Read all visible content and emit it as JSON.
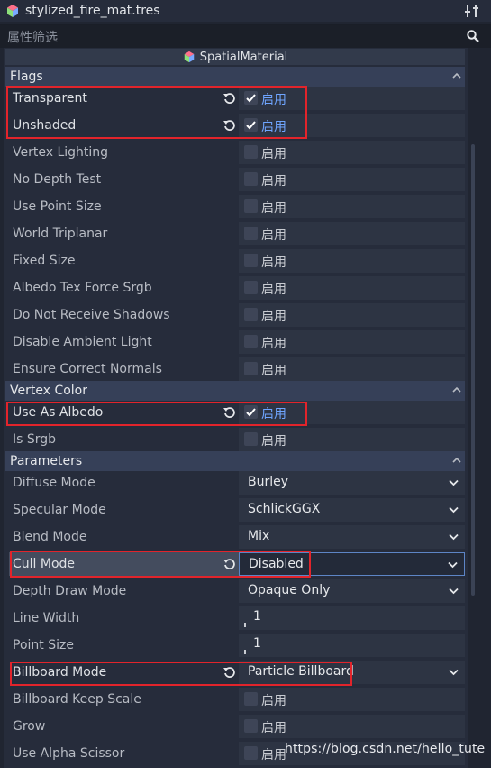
{
  "header": {
    "file_title": "stylized_fire_mat.tres",
    "resource_icon": "cube-icon",
    "tools_icon": "tools-icon"
  },
  "filter": {
    "placeholder": "属性筛选",
    "search_icon": "search-icon"
  },
  "material": {
    "class_name": "SpatialMaterial",
    "icon": "spatial-material-icon"
  },
  "enable_label": "启用",
  "sections": {
    "flags": "Flags",
    "vertex_color": "Vertex Color",
    "parameters": "Parameters"
  },
  "flags": [
    {
      "label": "Transparent",
      "checked": true
    },
    {
      "label": "Unshaded",
      "checked": true
    },
    {
      "label": "Vertex Lighting",
      "checked": false
    },
    {
      "label": "No Depth Test",
      "checked": false
    },
    {
      "label": "Use Point Size",
      "checked": false
    },
    {
      "label": "World Triplanar",
      "checked": false
    },
    {
      "label": "Fixed Size",
      "checked": false
    },
    {
      "label": "Albedo Tex Force Srgb",
      "checked": false
    },
    {
      "label": "Do Not Receive Shadows",
      "checked": false
    },
    {
      "label": "Disable Ambient Light",
      "checked": false
    },
    {
      "label": "Ensure Correct Normals",
      "checked": false
    }
  ],
  "vertex_color": [
    {
      "label": "Use As Albedo",
      "checked": true
    },
    {
      "label": "Is Srgb",
      "checked": false
    }
  ],
  "parameters": {
    "diffuse_mode": {
      "label": "Diffuse Mode",
      "value": "Burley"
    },
    "specular_mode": {
      "label": "Specular Mode",
      "value": "SchlickGGX"
    },
    "blend_mode": {
      "label": "Blend Mode",
      "value": "Mix"
    },
    "cull_mode": {
      "label": "Cull Mode",
      "value": "Disabled"
    },
    "depth_draw_mode": {
      "label": "Depth Draw Mode",
      "value": "Opaque Only"
    },
    "line_width": {
      "label": "Line Width",
      "value": "1"
    },
    "point_size": {
      "label": "Point Size",
      "value": "1"
    },
    "billboard_mode": {
      "label": "Billboard Mode",
      "value": "Particle Billboard"
    },
    "billboard_keep_scale": {
      "label": "Billboard Keep Scale",
      "checked": false
    },
    "grow": {
      "label": "Grow",
      "checked": false
    },
    "use_alpha_scissor": {
      "label": "Use Alpha Scissor",
      "checked": false
    }
  },
  "watermark": "https://blog.csdn.net/hello_tute",
  "colors": {
    "accent": "#6fa5ff",
    "highlight_box": "#e2242b",
    "focus_border": "#5d85c6"
  }
}
